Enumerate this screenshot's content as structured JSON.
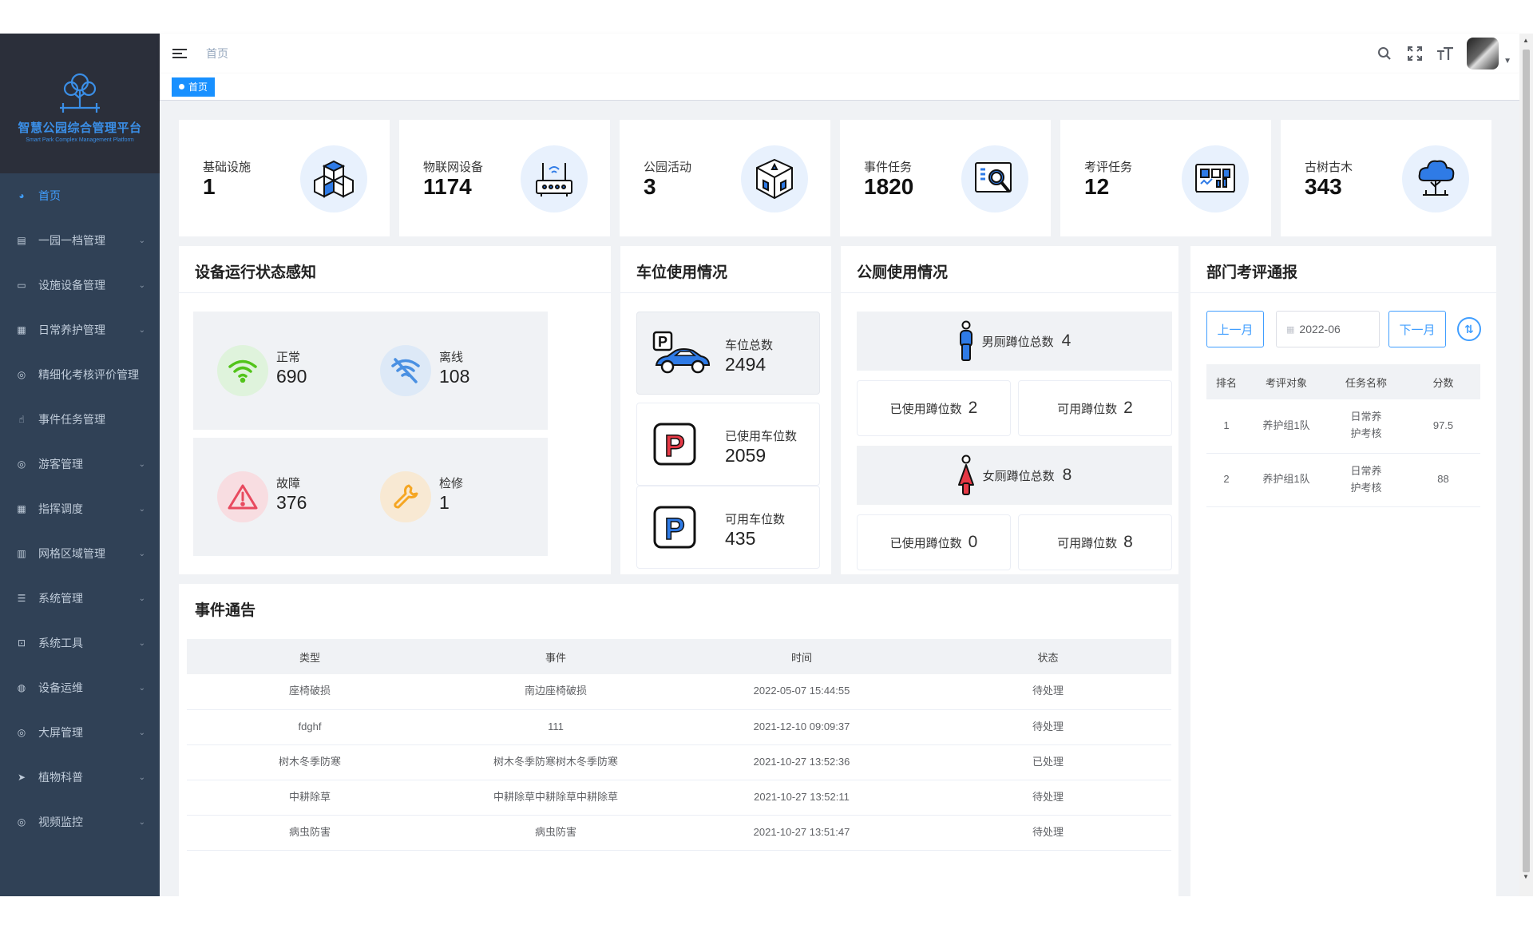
{
  "sidebar": {
    "logo_title": "智慧公园综合管理平台",
    "logo_subtitle": "Smart Park Complex Management Platform",
    "items": [
      {
        "label": "首页",
        "icon": "dashboard-icon",
        "active": true,
        "has_children": false
      },
      {
        "label": "一园一档管理",
        "icon": "document-icon",
        "has_children": true
      },
      {
        "label": "设施设备管理",
        "icon": "monitor-icon",
        "has_children": true
      },
      {
        "label": "日常养护管理",
        "icon": "grid-icon",
        "has_children": true
      },
      {
        "label": "精细化考核评价管理",
        "icon": "target-icon",
        "has_children": false
      },
      {
        "label": "事件任务管理",
        "icon": "hand-icon",
        "has_children": false
      },
      {
        "label": "游客管理",
        "icon": "target-icon",
        "has_children": true
      },
      {
        "label": "指挥调度",
        "icon": "grid-icon",
        "has_children": true
      },
      {
        "label": "网格区域管理",
        "icon": "table-icon",
        "has_children": true
      },
      {
        "label": "系统管理",
        "icon": "list-icon",
        "has_children": true
      },
      {
        "label": "系统工具",
        "icon": "toolbox-icon",
        "has_children": true
      },
      {
        "label": "设备运维",
        "icon": "globe-icon",
        "has_children": true
      },
      {
        "label": "大屏管理",
        "icon": "target-icon",
        "has_children": true
      },
      {
        "label": "植物科普",
        "icon": "send-icon",
        "has_children": true
      },
      {
        "label": "视频监控",
        "icon": "target-icon",
        "has_children": true
      }
    ]
  },
  "header": {
    "breadcrumb": "首页",
    "icons": [
      "search-icon",
      "fullscreen-icon",
      "font-size-icon"
    ]
  },
  "tags": [
    {
      "label": "首页",
      "active": true
    }
  ],
  "stats": [
    {
      "label": "基础设施",
      "value": "1",
      "icon": "cubes-icon"
    },
    {
      "label": "物联网设备",
      "value": "1174",
      "icon": "router-icon"
    },
    {
      "label": "公园活动",
      "value": "3",
      "icon": "activity-box-icon"
    },
    {
      "label": "事件任务",
      "value": "1820",
      "icon": "magnifier-screen-icon"
    },
    {
      "label": "考评任务",
      "value": "12",
      "icon": "dashboard-board-icon"
    },
    {
      "label": "古树古木",
      "value": "343",
      "icon": "tree-icon"
    }
  ],
  "device_status": {
    "title": "设备运行状态感知",
    "items": [
      {
        "label": "正常",
        "value": "690",
        "icon": "wifi-icon",
        "color": "#52c41a",
        "bg": "#dff3dc"
      },
      {
        "label": "离线",
        "value": "108",
        "icon": "wifi-off-icon",
        "color": "#4a90e2",
        "bg": "#dde9f7"
      },
      {
        "label": "故障",
        "value": "376",
        "icon": "warning-icon",
        "color": "#e84a5f",
        "bg": "#f8dde1"
      },
      {
        "label": "检修",
        "value": "1",
        "icon": "wrench-icon",
        "color": "#f5a623",
        "bg": "#f8e9d3"
      }
    ]
  },
  "parking": {
    "title": "车位使用情况",
    "items": [
      {
        "label": "车位总数",
        "value": "2494",
        "icon": "car-parking-icon"
      },
      {
        "label": "已使用车位数",
        "value": "2059",
        "icon": "parking-red-icon"
      },
      {
        "label": "可用车位数",
        "value": "435",
        "icon": "parking-blue-icon"
      }
    ]
  },
  "toilet": {
    "title": "公厕使用情况",
    "male_total_label": "男厕蹲位总数",
    "male_total": "4",
    "male_used_label": "已使用蹲位数",
    "male_used": "2",
    "male_free_label": "可用蹲位数",
    "male_free": "2",
    "female_total_label": "女厕蹲位总数",
    "female_total": "8",
    "female_used_label": "已使用蹲位数",
    "female_used": "0",
    "female_free_label": "可用蹲位数",
    "female_free": "8"
  },
  "department": {
    "title": "部门考评通报",
    "prev_label": "上一月",
    "next_label": "下一月",
    "month": "2022-06",
    "columns": [
      "排名",
      "考评对象",
      "任务名称",
      "分数"
    ],
    "rows": [
      [
        "1",
        "养护组1队",
        "日常养护考核",
        "97.5"
      ],
      [
        "2",
        "养护组1队",
        "日常养护考核",
        "88"
      ]
    ]
  },
  "events": {
    "title": "事件通告",
    "columns": [
      "类型",
      "事件",
      "时间",
      "状态"
    ],
    "rows": [
      [
        "座椅破损",
        "南边座椅破损",
        "2022-05-07 15:44:55",
        "待处理"
      ],
      [
        "fdghf",
        "111",
        "2021-12-10 09:09:37",
        "待处理"
      ],
      [
        "树木冬季防寒",
        "树木冬季防寒树木冬季防寒",
        "2021-10-27 13:52:36",
        "已处理"
      ],
      [
        "中耕除草",
        "中耕除草中耕除草中耕除草",
        "2021-10-27 13:52:11",
        "待处理"
      ],
      [
        "病虫防害",
        "病虫防害",
        "2021-10-27 13:51:47",
        "待处理"
      ]
    ]
  }
}
